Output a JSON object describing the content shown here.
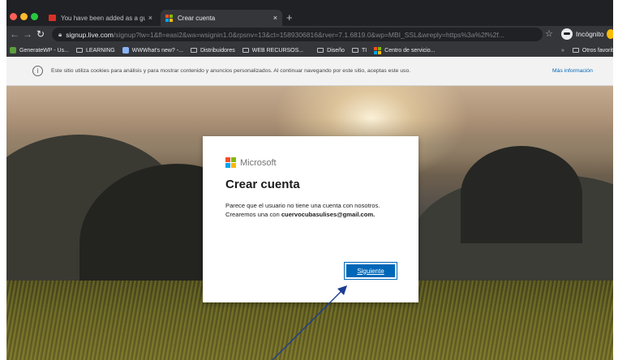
{
  "browser": {
    "tabs": [
      {
        "title": "You have been added as a gue",
        "active": false
      },
      {
        "title": "Crear cuenta",
        "active": true
      }
    ],
    "new_tab_glyph": "+",
    "close_glyph": "×",
    "url_host": "signup.live.com",
    "url_path": "/signup?lw=1&fl=easi2&wa=wsignin1.0&rpsnv=13&ct=1589306816&rver=7.1.6819.0&wp=MBI_SSL&wreply=https%3a%2f%2f...",
    "incognito_label": "Incógnito",
    "bookmarks": [
      {
        "label": "GenerateWP - Us...",
        "icon": "generatewp-icon"
      },
      {
        "label": "LEARNING",
        "icon": "folder-icon"
      },
      {
        "label": "WWWhat's new? -...",
        "icon": "wwwhat-icon"
      },
      {
        "label": "Distribuidores",
        "icon": "folder-icon"
      },
      {
        "label": "WEB RECURSOS...",
        "icon": "folder-icon"
      },
      {
        "label": "Diseño",
        "icon": "folder-icon"
      },
      {
        "label": "TI",
        "icon": "folder-icon"
      },
      {
        "label": "Centro de servicio...",
        "icon": "ms-icon"
      }
    ],
    "other_bookmarks": "Otros favorit",
    "bookmarks_overflow": "»"
  },
  "cookie_banner": {
    "text": "Este sitio utiliza cookies para análisis y para mostrar contenido y anuncios personalizados. Al continuar navegando por este sitio, aceptas este uso.",
    "link": "Más información"
  },
  "card": {
    "brand": "Microsoft",
    "title": "Crear cuenta",
    "message": "Parece que el usuario no tiene una cuenta con nosotros. Crearemos una con",
    "email": "cuervocubasulises@gmail.com.",
    "next_button": "Siguiente"
  },
  "colors": {
    "accent": "#0067b8",
    "browser_dark": "#202124",
    "toolbar": "#35363a"
  }
}
